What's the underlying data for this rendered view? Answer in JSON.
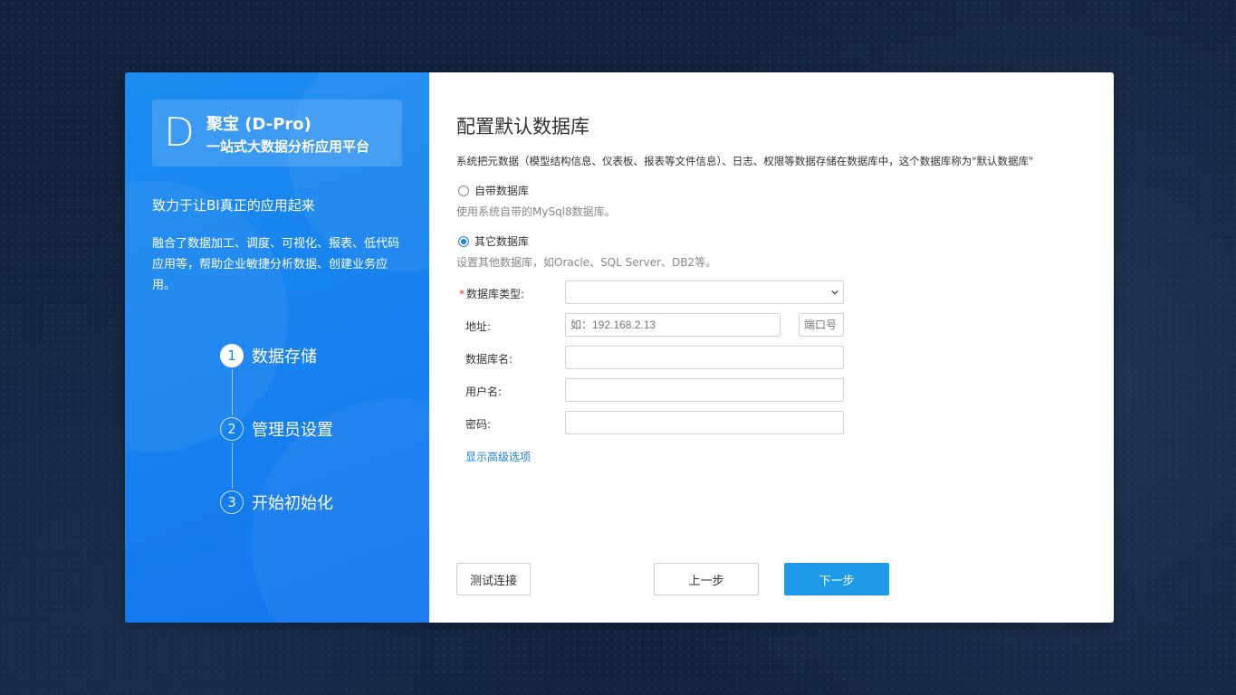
{
  "brand": {
    "logo_letter": "D",
    "name": "聚宝 (D-Pro)",
    "subtitle": "一站式大数据分析应用平台"
  },
  "slogan": "致力于让BI真正的应用起来",
  "description": "融合了数据加工、调度、可视化、报表、低代码应用等，帮助企业敏捷分析数据、创建业务应用。",
  "steps": [
    {
      "number": "1",
      "label": "数据存储",
      "active": true
    },
    {
      "number": "2",
      "label": "管理员设置",
      "active": false
    },
    {
      "number": "3",
      "label": "开始初始化",
      "active": false
    }
  ],
  "main": {
    "title": "配置默认数据库",
    "intro": "系统把元数据（模型结构信息、仪表板、报表等文件信息）、日志、权限等数据存储在数据库中，这个数据库称为\"默认数据库\"",
    "options": [
      {
        "label": "自带数据库",
        "hint": "使用系统自带的MySql8数据库。",
        "selected": false
      },
      {
        "label": "其它数据库",
        "hint": "设置其他数据库，如Oracle、SQL Server、DB2等。",
        "selected": true
      }
    ],
    "form": {
      "db_type_label": "数据库类型:",
      "db_type_required_mark": "*",
      "db_type_value": "",
      "address_label": "地址:",
      "address_placeholder": "如：192.168.2.13",
      "port_placeholder": "端口号",
      "dbname_label": "数据库名:",
      "username_label": "用户名:",
      "password_label": "密码:"
    },
    "advanced_link": "显示高级选项",
    "buttons": {
      "test": "测试连接",
      "prev": "上一步",
      "next": "下一步"
    }
  },
  "colors": {
    "accent": "#1b7fe5",
    "primary_button": "#1e9be8",
    "left_panel": "#1883ef",
    "background": "#13233d"
  }
}
